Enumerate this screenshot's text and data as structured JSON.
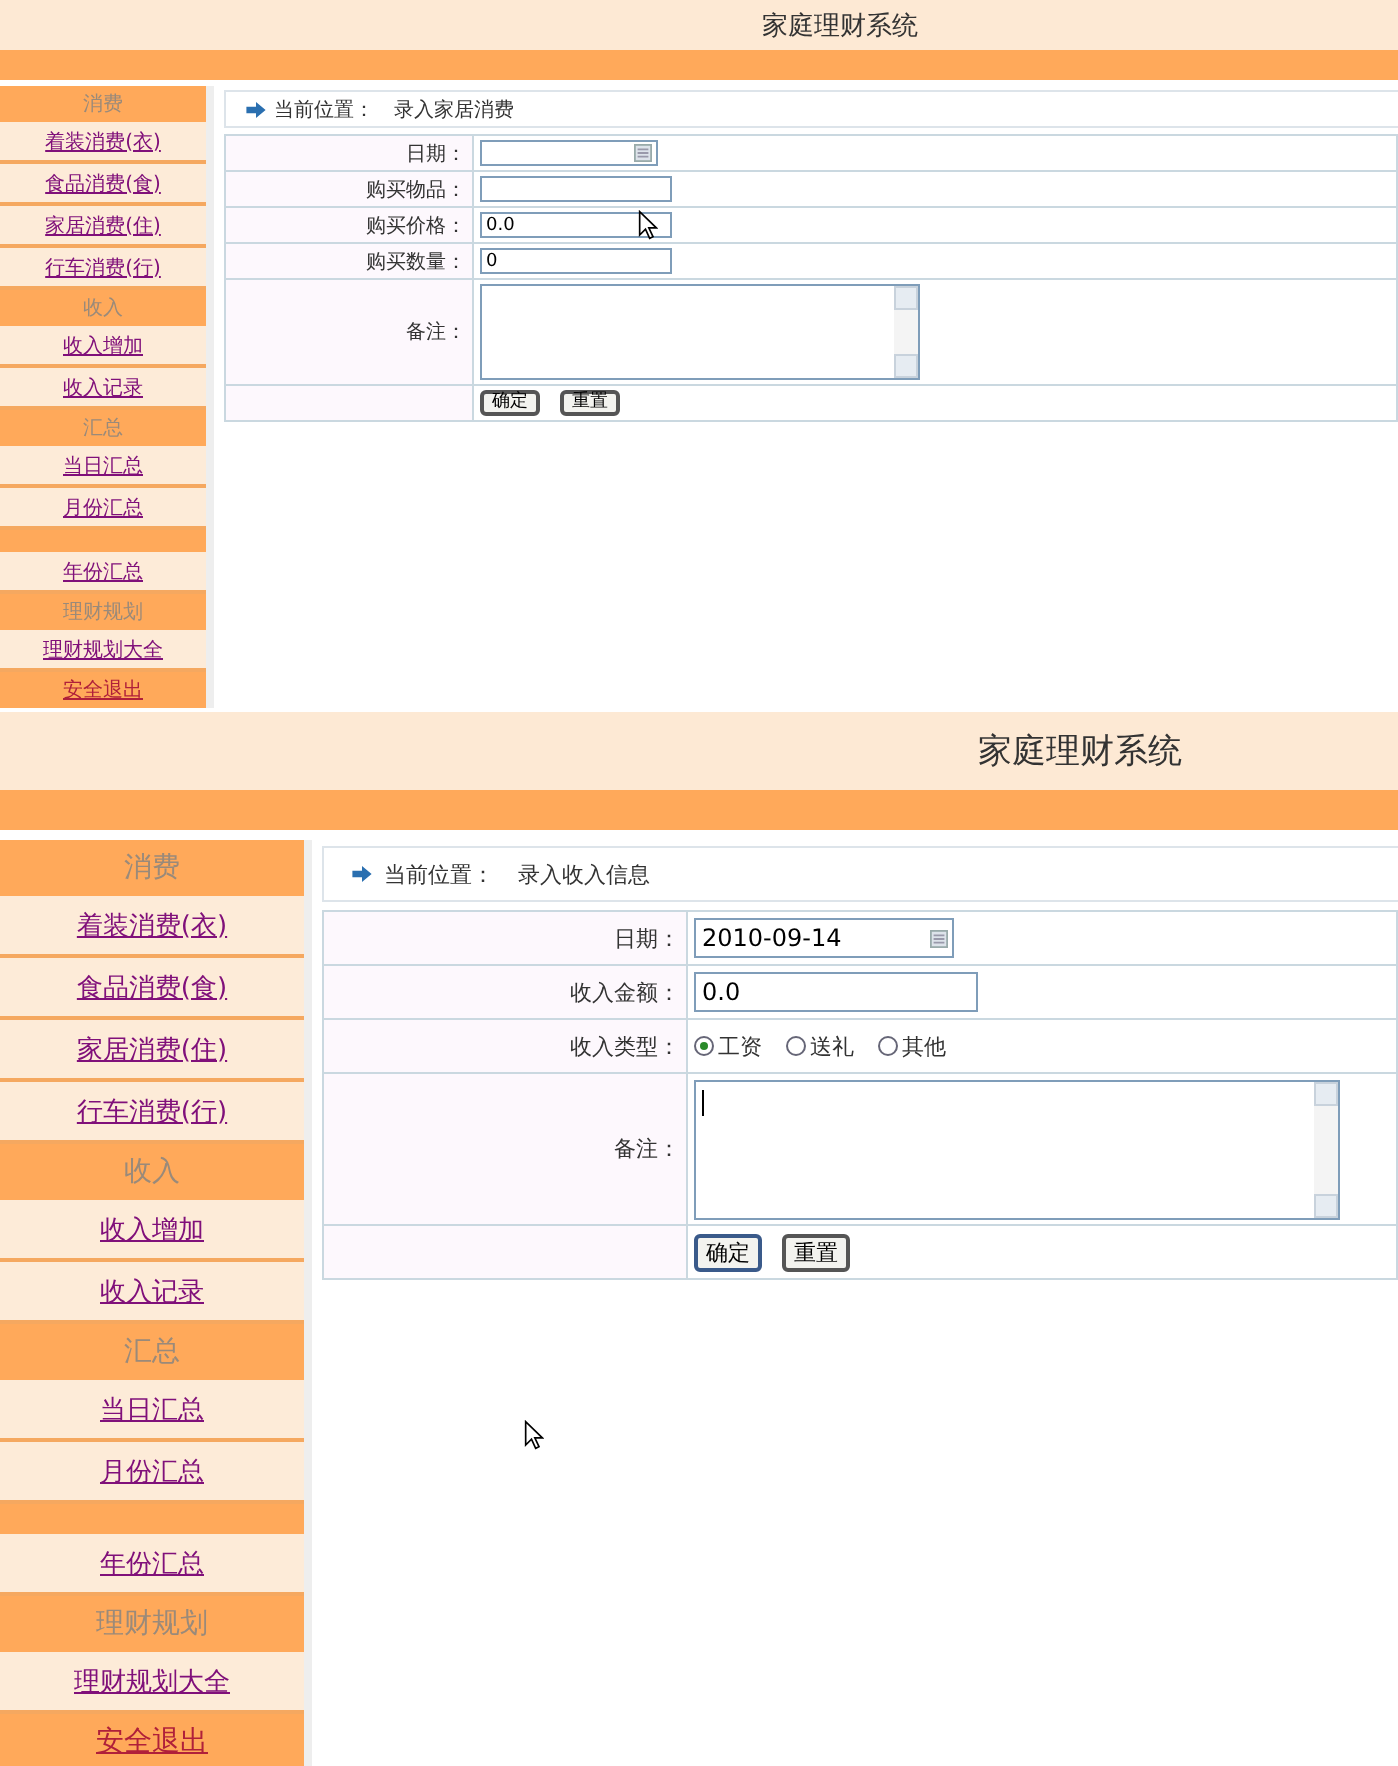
{
  "screens": [
    {
      "title": "家庭理财系统",
      "sidebar": [
        {
          "kind": "header",
          "label": "消费"
        },
        {
          "kind": "link",
          "label": "着装消费(衣)"
        },
        {
          "kind": "link",
          "label": "食品消费(食)"
        },
        {
          "kind": "link",
          "label": "家居消费(住)"
        },
        {
          "kind": "link",
          "label": "行车消费(行)"
        },
        {
          "kind": "header",
          "label": "收入"
        },
        {
          "kind": "link",
          "label": "收入增加"
        },
        {
          "kind": "link",
          "label": "收入记录"
        },
        {
          "kind": "header",
          "label": "汇总"
        },
        {
          "kind": "link",
          "label": "当日汇总"
        },
        {
          "kind": "link",
          "label": "月份汇总"
        },
        {
          "kind": "spacer"
        },
        {
          "kind": "link",
          "label": "年份汇总"
        },
        {
          "kind": "header",
          "label": "理财规划"
        },
        {
          "kind": "link",
          "label": "理财规划大全"
        },
        {
          "kind": "exit",
          "label": "安全退出"
        }
      ],
      "breadcrumb": {
        "label": "当前位置：",
        "page": "录入家居消费"
      },
      "form": [
        {
          "kind": "date",
          "label": "日期："
        },
        {
          "kind": "text",
          "label": "购买物品："
        },
        {
          "kind": "text",
          "label": "购买价格：",
          "value": "0.0"
        },
        {
          "kind": "text",
          "label": "购买数量：",
          "value": "0"
        },
        {
          "kind": "textarea",
          "label": "备注："
        },
        {
          "kind": "buttons",
          "buttons": [
            "确定",
            "重置"
          ]
        }
      ]
    },
    {
      "title": "家庭理财系统",
      "sidebar": [
        {
          "kind": "header",
          "label": "消费"
        },
        {
          "kind": "link",
          "label": "着装消费(衣)"
        },
        {
          "kind": "link",
          "label": "食品消费(食)"
        },
        {
          "kind": "link",
          "label": "家居消费(住)"
        },
        {
          "kind": "link",
          "label": "行车消费(行)"
        },
        {
          "kind": "header",
          "label": "收入"
        },
        {
          "kind": "link",
          "label": "收入增加"
        },
        {
          "kind": "link",
          "label": "收入记录"
        },
        {
          "kind": "header",
          "label": "汇总"
        },
        {
          "kind": "link",
          "label": "当日汇总"
        },
        {
          "kind": "link",
          "label": "月份汇总"
        },
        {
          "kind": "spacer"
        },
        {
          "kind": "link",
          "label": "年份汇总"
        },
        {
          "kind": "header",
          "label": "理财规划"
        },
        {
          "kind": "link",
          "label": "理财规划大全"
        },
        {
          "kind": "exit",
          "label": "安全退出"
        }
      ],
      "breadcrumb": {
        "label": "当前位置：",
        "page": "录入收入信息"
      },
      "form": [
        {
          "kind": "date",
          "label": "日期：",
          "value": "2010-09-14"
        },
        {
          "kind": "text",
          "label": "收入金额：",
          "value": "0.0"
        },
        {
          "kind": "radio",
          "label": "收入类型：",
          "options": [
            {
              "label": "工资",
              "selected": true
            },
            {
              "label": "送礼",
              "selected": false
            },
            {
              "label": "其他",
              "selected": false
            }
          ]
        },
        {
          "kind": "textarea",
          "label": "备注：",
          "focused": true
        },
        {
          "kind": "buttons",
          "buttons": [
            "确定",
            "重置"
          ]
        }
      ]
    }
  ]
}
